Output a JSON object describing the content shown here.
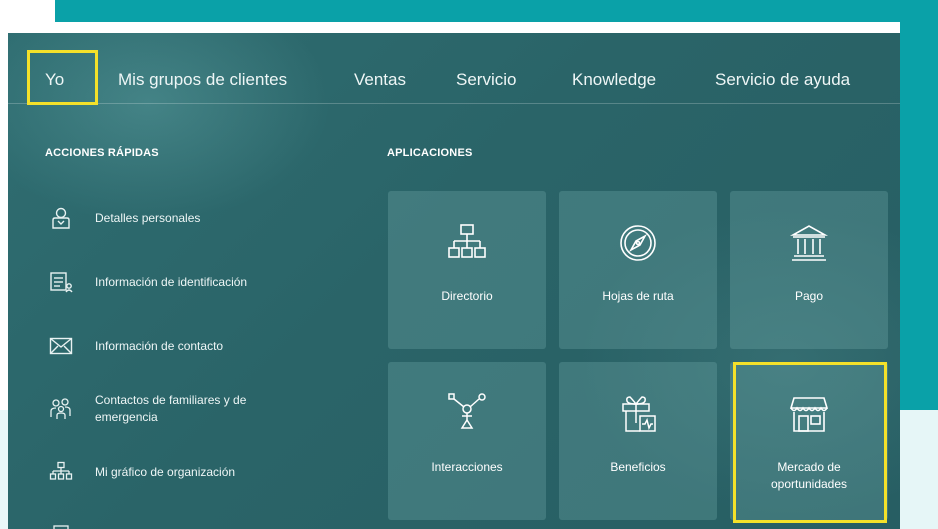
{
  "nav": {
    "items": [
      "Yo",
      "Mis grupos de clientes",
      "Ventas",
      "Servicio",
      "Knowledge",
      "Servicio de ayuda"
    ]
  },
  "quick_actions": {
    "title": "ACCIONES RÁPIDAS",
    "items": [
      {
        "label": "Detalles personales",
        "icon": "person-details-icon"
      },
      {
        "label": "Información de identificación",
        "icon": "id-card-icon"
      },
      {
        "label": "Información de contacto",
        "icon": "envelope-icon"
      },
      {
        "label": "Contactos de familiares y de emergencia",
        "icon": "family-icon"
      },
      {
        "label": "Mi gráfico de organización",
        "icon": "org-chart-icon"
      }
    ]
  },
  "applications": {
    "title": "APLICACIONES",
    "tiles": [
      {
        "label": "Directorio",
        "icon": "directory-icon"
      },
      {
        "label": "Hojas de ruta",
        "icon": "compass-icon"
      },
      {
        "label": "Pago",
        "icon": "bank-icon"
      },
      {
        "label": "Interacciones",
        "icon": "interactions-icon"
      },
      {
        "label": "Beneficios",
        "icon": "gift-icon"
      },
      {
        "label": "Mercado de oportunidades",
        "icon": "storefront-icon"
      }
    ]
  },
  "colors": {
    "highlight": "#f4e12a",
    "teal_frame": "#0aa1a8",
    "panel_bg": "#2a6468"
  }
}
